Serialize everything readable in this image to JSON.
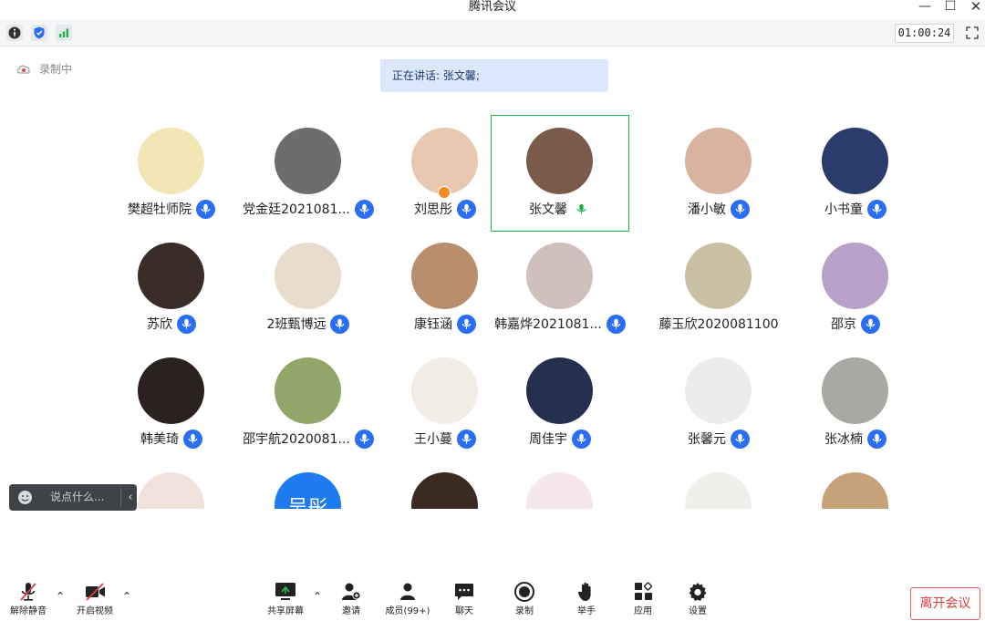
{
  "window": {
    "title": "腾讯会议",
    "minimize": "—",
    "maximize": "☐",
    "close": "✕"
  },
  "infobar": {
    "timer": "01:00:24"
  },
  "recording": {
    "label": "录制中"
  },
  "speaking": {
    "text": "正在讲话: 张文馨;"
  },
  "participants": [
    {
      "name": "樊超牡师院",
      "mic": "blue",
      "color": "#f3e6b5"
    },
    {
      "name": "党金廷2021081...",
      "mic": "blue",
      "color": "#6d6d6d"
    },
    {
      "name": "刘思彤",
      "mic": "blue",
      "color": "#e9c8b2",
      "host": true
    },
    {
      "name": "张文馨",
      "mic": "green",
      "color": "#7a5a4a",
      "active": true
    },
    {
      "name": "潘小敏",
      "mic": "blue",
      "color": "#d7b3a0"
    },
    {
      "name": "小书童",
      "mic": "blue",
      "color": "#2b3b6b"
    },
    {
      "name": "苏欣",
      "mic": "blue",
      "color": "#3a2c28"
    },
    {
      "name": "2班甄博远",
      "mic": "blue",
      "color": "#e8dccd"
    },
    {
      "name": "康钰涵",
      "mic": "blue",
      "color": "#b88e6c"
    },
    {
      "name": "韩嘉烨2021081...",
      "mic": "blue",
      "color": "#cfc0bd"
    },
    {
      "name": "藤玉欣2020081100",
      "mic": "none",
      "color": "#c9c0a3"
    },
    {
      "name": "邵京",
      "mic": "blue",
      "color": "#b9a2c9"
    },
    {
      "name": "韩美琦",
      "mic": "blue",
      "color": "#2a2220"
    },
    {
      "name": "邵宇航2020081...",
      "mic": "blue",
      "color": "#93a66a"
    },
    {
      "name": "王小蔓",
      "mic": "blue",
      "color": "#f2ece6"
    },
    {
      "name": "周佳宇",
      "mic": "blue",
      "color": "#24304f"
    },
    {
      "name": "张馨元",
      "mic": "blue",
      "color": "#ececec"
    },
    {
      "name": "张冰楠",
      "mic": "blue",
      "color": "#a9a8a3"
    },
    {
      "name": "",
      "mic": "none",
      "color": "#f2e2dc"
    },
    {
      "name": "",
      "mic": "none",
      "color": "#1e7bf0",
      "initials": "吴彤"
    },
    {
      "name": "",
      "mic": "none",
      "color": "#3a2a22"
    },
    {
      "name": "",
      "mic": "none",
      "color": "#f6e6ee"
    },
    {
      "name": "",
      "mic": "none",
      "color": "#f1efec"
    },
    {
      "name": "",
      "mic": "none",
      "color": "#c7a178"
    }
  ],
  "chat": {
    "placeholder": "说点什么..."
  },
  "toolbar": {
    "unmute": "解除静音",
    "video": "开启视频",
    "share": "共享屏幕",
    "invite": "邀请",
    "members": "成员(99+)",
    "chat": "聊天",
    "record": "录制",
    "raise_hand": "举手",
    "apps": "应用",
    "settings": "设置",
    "leave": "离开会议"
  },
  "colors": {
    "accent_blue": "#2a6ef5",
    "active_green": "#22b14c",
    "leave_red": "#e03e3e",
    "speaking_bg": "#dbe7fb"
  }
}
